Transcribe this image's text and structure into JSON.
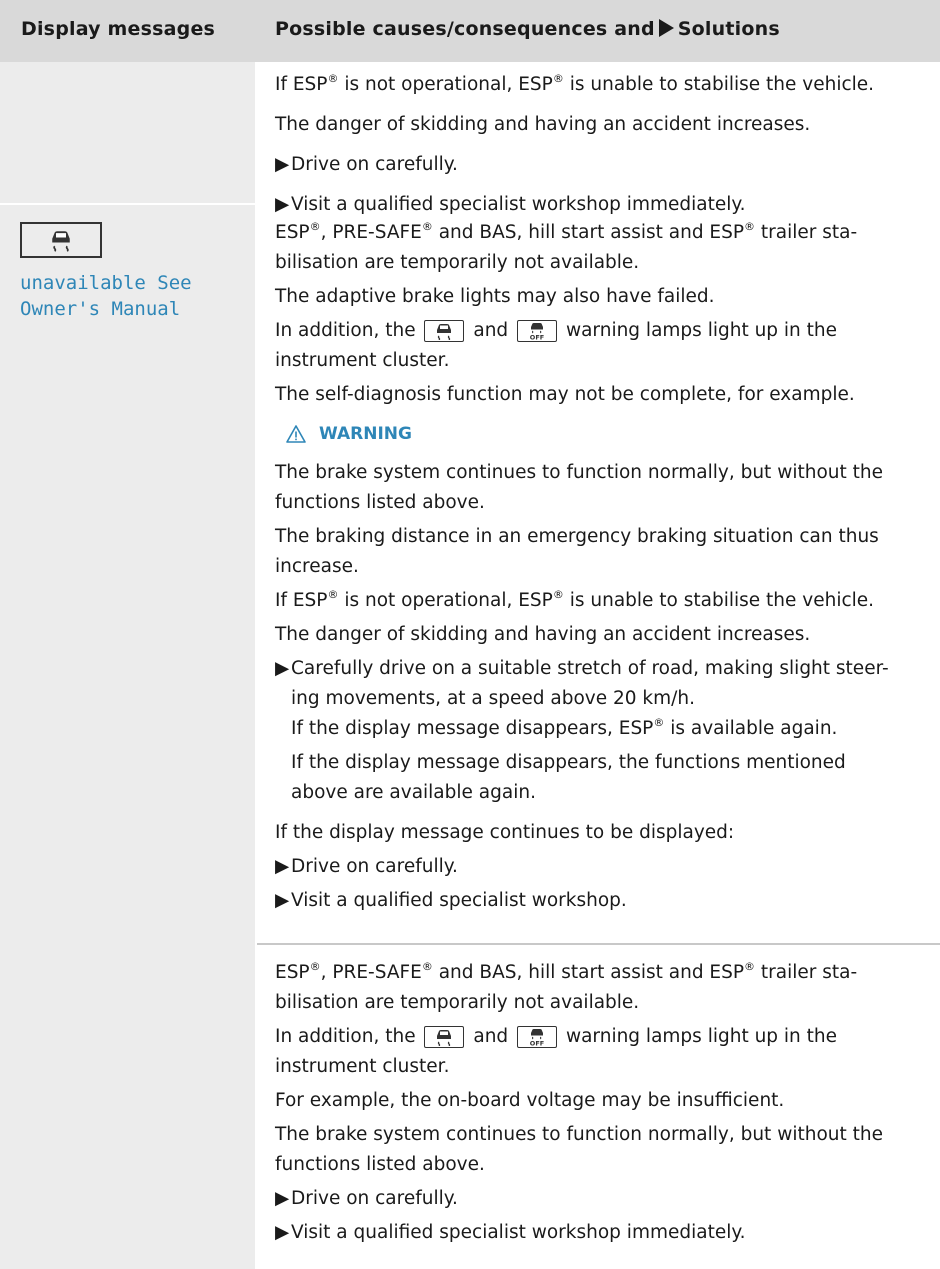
{
  "header": {
    "col1": "Display messages",
    "col2_a": "Possible causes/consequences and",
    "col2_b": "Solutions"
  },
  "section0": {
    "line1_a": "If ESP",
    "line1_b": " is not operational, ESP",
    "line1_c": " is unable to stabilise the vehicle.",
    "line2": "The danger of skidding and having an accident increases.",
    "bullet1": "Drive on carefully.",
    "bullet2": "Visit a qualified specialist workshop immediately."
  },
  "display_message": {
    "icon": "esp-skid-car-icon",
    "text": "unavailable See Owner's Manual"
  },
  "section1": {
    "l1_a": "ESP",
    "l1_b": ", PRE-SAFE",
    "l1_c": " and BAS, hill start assist and ESP",
    "l1_d": " trailer sta-",
    "l2": "bilisation are temporarily not available.",
    "l3": "The adaptive brake lights may also have failed.",
    "l4_a": "In addition, the",
    "l4_b": "and",
    "l4_c": "warning lamps light up in the",
    "l5": "instrument cluster.",
    "l6": "The self-diagnosis function may not be complete, for example.",
    "warning_title": "WARNING",
    "w1": "The brake system continues to function normally, but without the",
    "w2": "functions listed above.",
    "w3": "The braking distance in an emergency braking situation can thus",
    "w4": "increase.",
    "w5_a": "If ESP",
    "w5_b": " is not operational, ESP",
    "w5_c": " is unable to stabilise the vehicle.",
    "w6": "The danger of skidding and having an accident increases.",
    "b1_l1": "Carefully drive on a suitable stretch of road, making slight steer-",
    "b1_l2": "ing movements, at a speed above 20 km/h.",
    "b1_l3_a": "If the display message disappears, ESP",
    "b1_l3_b": " is available again.",
    "b1_l4": "If the display message disappears, the functions mentioned",
    "b1_l5": "above are available again.",
    "cont": "If the display message continues to be displayed:",
    "b2": "Drive on carefully.",
    "b3": "Visit a qualified specialist workshop."
  },
  "section2": {
    "l1_a": "ESP",
    "l1_b": ", PRE-SAFE",
    "l1_c": " and BAS, hill start assist and ESP",
    "l1_d": " trailer sta-",
    "l2": "bilisation are temporarily not available.",
    "l3_a": "In addition, the",
    "l3_b": "and",
    "l3_c": "warning lamps light up in the",
    "l4": "instrument cluster.",
    "l5": "For example, the on-board voltage may be insufficient.",
    "l6": "The brake system continues to function normally, but without the",
    "l7": "functions listed above.",
    "b1": "Drive on carefully.",
    "b2": "Visit a qualified specialist workshop immediately."
  },
  "symbols": {
    "registered": "®",
    "bullet": "▶"
  },
  "colors": {
    "accent": "#2e86b7",
    "header_bg": "#d9d9d9",
    "left_col_bg": "#ececec"
  }
}
